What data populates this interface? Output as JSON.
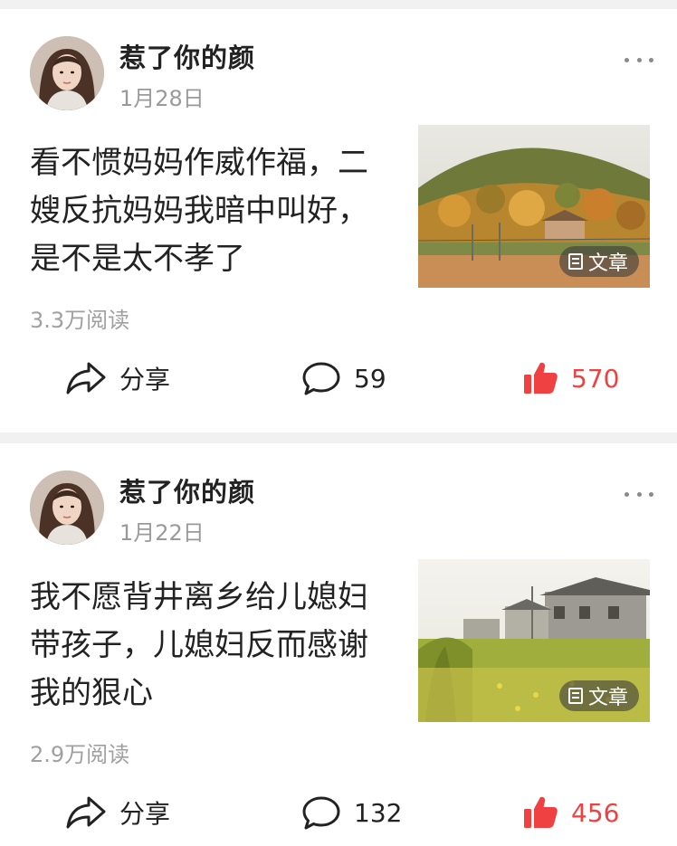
{
  "posts": [
    {
      "author": "惹了你的颜",
      "date": "1月28日",
      "title": "看不惯妈妈作威作福，二嫂反抗妈妈我暗中叫好，是不是太不孝了",
      "thumb_badge": "文章",
      "reads": "3.3万阅读",
      "share_label": "分享",
      "comments": "59",
      "likes": "570"
    },
    {
      "author": "惹了你的颜",
      "date": "1月22日",
      "title": "我不愿背井离乡给儿媳妇带孩子，儿媳妇反而感谢我的狠心",
      "thumb_badge": "文章",
      "reads": "2.9万阅读",
      "share_label": "分享",
      "comments": "132",
      "likes": "456"
    }
  ],
  "colors": {
    "like_accent": "#f04142",
    "text_primary": "#222222",
    "text_secondary": "#9a9a9a",
    "feed_background": "#f1f1f1"
  },
  "icons": [
    "avatar",
    "more-icon",
    "share-icon",
    "comment-icon",
    "thumbs-up-icon",
    "article-doc-icon"
  ]
}
